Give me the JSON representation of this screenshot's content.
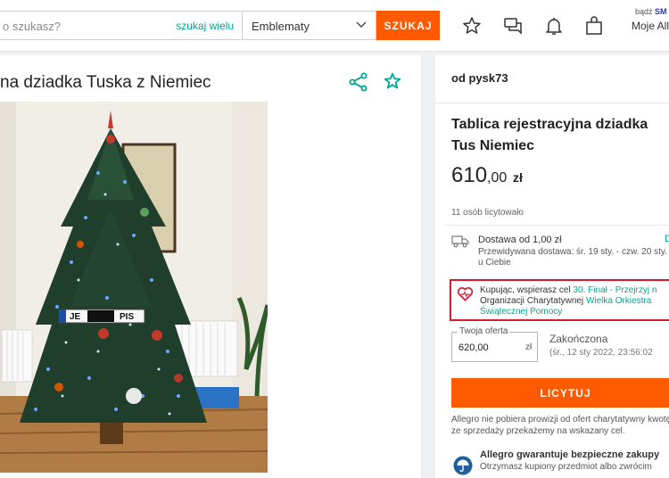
{
  "header": {
    "search_placeholder": "o szukasz?",
    "search_many": "szukaj wielu",
    "category": "Emblematy",
    "search_button": "SZUKAJ",
    "smart_prefix": "bądź",
    "smart_brand": "SM",
    "my_allegro": "Moje All"
  },
  "offer": {
    "title": "na dziadka Tuska z Niemiec",
    "plate_left": "JE",
    "plate_right": "PIS"
  },
  "sidebar": {
    "seller": "od pysk73",
    "title": "Tablica rejestracyjna dziadka Tus Niemiec",
    "price_int": "610",
    "price_dec": ",00",
    "currency": "zł",
    "bidders": "11 osób licytowało",
    "delivery_main": "Dostawa od 1,00 zł",
    "delivery_link": "D",
    "delivery_estimate": "Przewidywana dostawa: śr. 19 sty. - czw. 20 sty. u Ciebie",
    "charity_intro": "Kupując, wspierasz cel",
    "charity_link1": "30. Finał - Przejrzyj n",
    "charity_mid": "Organizacji Charytatywnej",
    "charity_link2": "Wielka Orkiestra",
    "charity_link3": "Świątecznej Pomocy",
    "bid_label": "Twoja oferta",
    "bid_value": "620,00",
    "bid_currency": "zł",
    "ended": "Zakończona",
    "ended_date": "(śr., 12 sty 2022, 23:56:02",
    "bid_button": "LICYTUJ",
    "note": "Allegro nie pobiera prowizji od ofert charytatywny kwotę ze sprzedaży przekażemy na wskazany cel.",
    "guarantee_title": "Allegro gwarantuje bezpieczne zakupy",
    "guarantee_sub": "Otrzymasz kupiony przedmiot albo zwrócim"
  },
  "colors": {
    "accent": "#ff5a00",
    "link": "#00a790",
    "highlight": "#d61a32"
  }
}
